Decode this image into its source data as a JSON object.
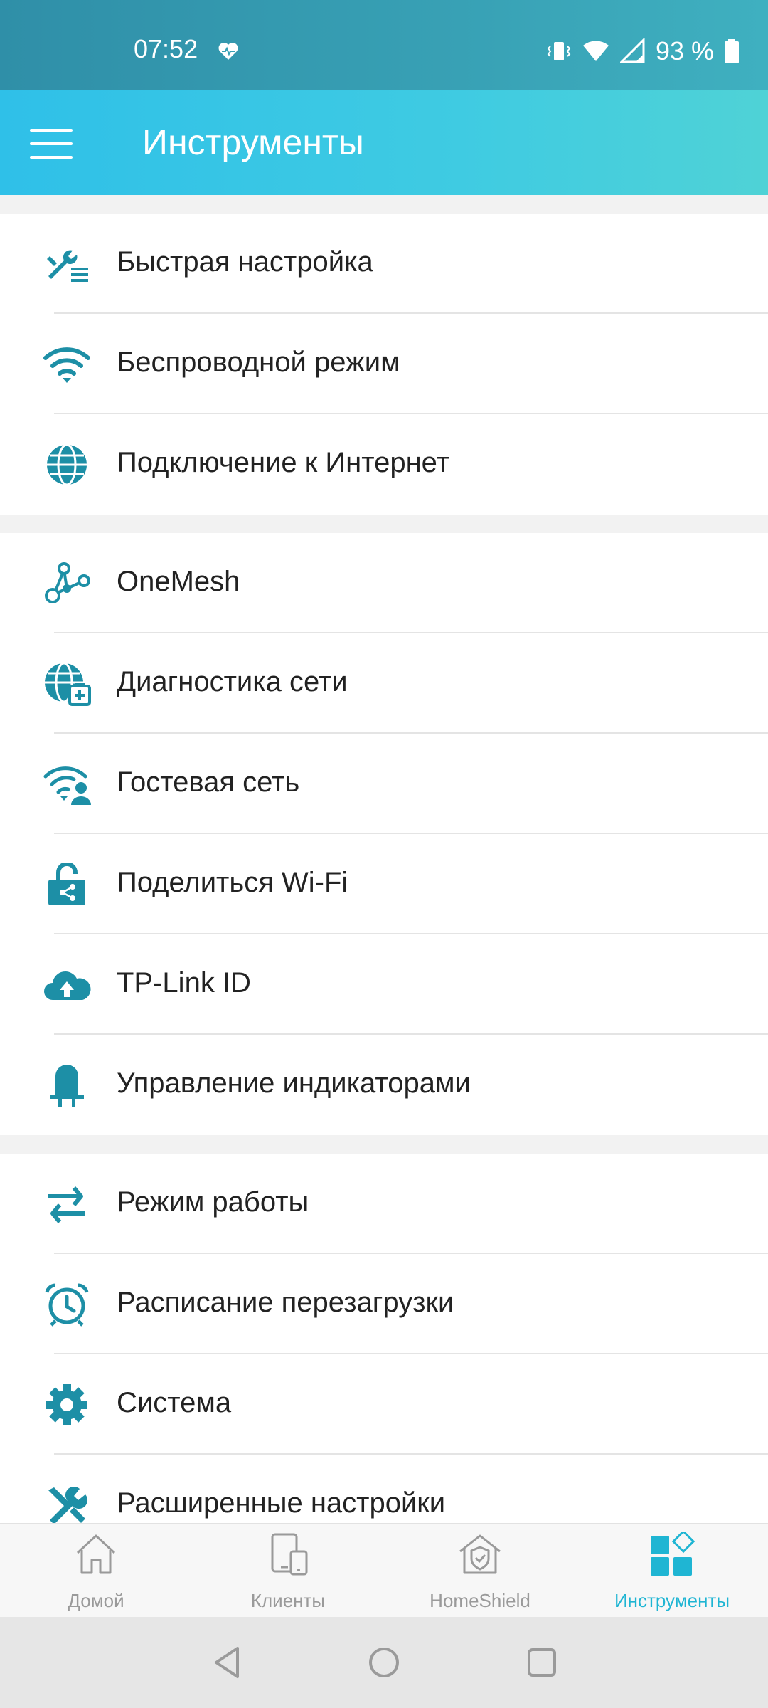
{
  "status_bar": {
    "time": "07:52",
    "battery": "93 %"
  },
  "app_bar": {
    "title": "Инструменты"
  },
  "groups": [
    {
      "items": [
        {
          "label": "Быстрая настройка",
          "icon": "quick-setup-icon"
        },
        {
          "label": "Беспроводной режим",
          "icon": "wifi-icon"
        },
        {
          "label": "Подключение к Интернет",
          "icon": "globe-icon"
        }
      ]
    },
    {
      "items": [
        {
          "label": "OneMesh",
          "icon": "mesh-icon"
        },
        {
          "label": "Диагностика сети",
          "icon": "network-diagnostics-icon"
        },
        {
          "label": "Гостевая сеть",
          "icon": "guest-network-icon"
        },
        {
          "label": "Поделиться Wi-Fi",
          "icon": "share-wifi-icon"
        },
        {
          "label": "TP-Link ID",
          "icon": "cloud-upload-icon"
        },
        {
          "label": "Управление индикаторами",
          "icon": "led-icon"
        }
      ]
    },
    {
      "items": [
        {
          "label": "Режим работы",
          "icon": "swap-arrows-icon"
        },
        {
          "label": "Расписание перезагрузки",
          "icon": "alarm-clock-icon"
        },
        {
          "label": "Система",
          "icon": "gear-icon"
        },
        {
          "label": "Расширенные настройки",
          "icon": "tools-icon"
        }
      ]
    }
  ],
  "bottom_nav": [
    {
      "label": "Домой",
      "icon": "home-icon",
      "active": false
    },
    {
      "label": "Клиенты",
      "icon": "devices-icon",
      "active": false
    },
    {
      "label": "HomeShield",
      "icon": "shield-icon",
      "active": false
    },
    {
      "label": "Инструменты",
      "icon": "tools-grid-icon",
      "active": true
    }
  ],
  "colors": {
    "accent": "#1fb5d3",
    "icon": "#1d8fa6",
    "inactive": "#9a9a9a"
  }
}
